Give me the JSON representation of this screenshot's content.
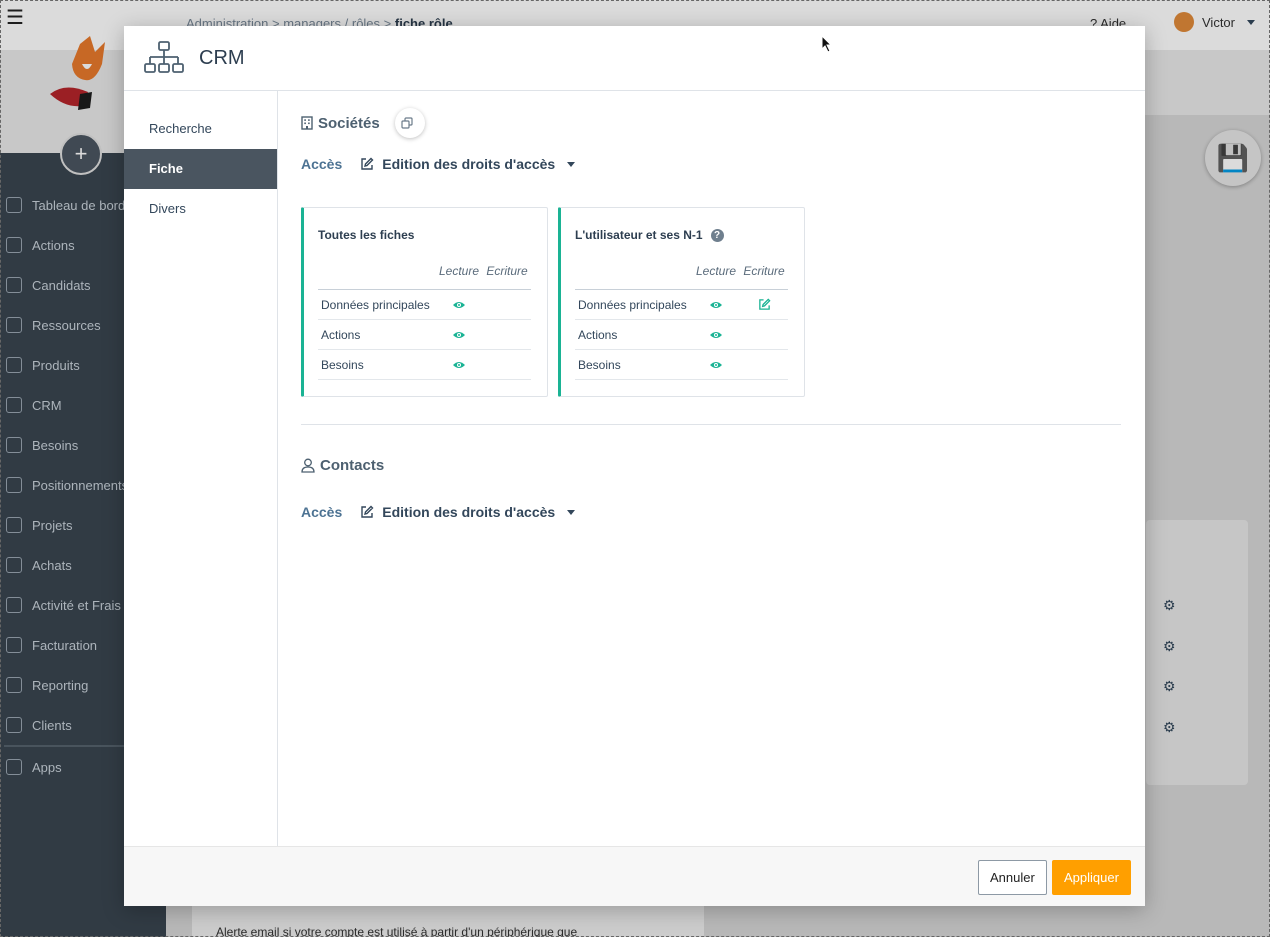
{
  "background": {
    "breadcrumb": [
      "Administration",
      "managers",
      "rôles",
      "fiche rôle"
    ],
    "help_label": "Aide",
    "user_name": "Victor",
    "nav_items": [
      {
        "label": "Tableau de bord",
        "icon": "dashboard-icon"
      },
      {
        "label": "Actions",
        "icon": "calendar-icon"
      },
      {
        "label": "Candidats",
        "icon": "graduation-cap-icon"
      },
      {
        "label": "Ressources",
        "icon": "people-icon"
      },
      {
        "label": "Produits",
        "icon": "book-icon"
      },
      {
        "label": "CRM",
        "icon": "hierarchy-icon"
      },
      {
        "label": "Besoins",
        "icon": "target-icon"
      },
      {
        "label": "Positionnements",
        "icon": "pin-icon"
      },
      {
        "label": "Projets",
        "icon": "briefcase-icon"
      },
      {
        "label": "Achats",
        "icon": "cart-icon"
      },
      {
        "label": "Activité et Frais",
        "icon": "edit-icon"
      },
      {
        "label": "Facturation",
        "icon": "invoice-icon"
      },
      {
        "label": "Reporting",
        "icon": "chart-icon"
      },
      {
        "label": "Clients",
        "icon": "building-icon"
      },
      {
        "label": "Apps",
        "icon": "cubes-icon"
      }
    ],
    "alert_text": "Alerte email si votre compte est utilisé à partir d'un périphérique que"
  },
  "modal": {
    "title": "CRM",
    "side_items": [
      {
        "label": "Recherche",
        "active": false
      },
      {
        "label": "Fiche",
        "active": true
      },
      {
        "label": "Divers",
        "active": false
      }
    ],
    "societes": {
      "title": "Sociétés",
      "access_label": "Accès",
      "edit_label": "Edition des droits d'accès",
      "cards": [
        {
          "title": "Toutes les fiches",
          "has_help": false,
          "col_read": "Lecture",
          "col_write": "Ecriture",
          "rows": [
            {
              "label": "Données principales",
              "read": true,
              "write": false
            },
            {
              "label": "Actions",
              "read": true,
              "write": false
            },
            {
              "label": "Besoins",
              "read": true,
              "write": false
            }
          ]
        },
        {
          "title": "L'utilisateur et ses N-1",
          "has_help": true,
          "col_read": "Lecture",
          "col_write": "Ecriture",
          "rows": [
            {
              "label": "Données principales",
              "read": true,
              "write": true
            },
            {
              "label": "Actions",
              "read": true,
              "write": false
            },
            {
              "label": "Besoins",
              "read": true,
              "write": false
            }
          ]
        }
      ]
    },
    "contacts": {
      "title": "Contacts",
      "access_label": "Accès",
      "edit_label": "Edition des droits d'accès"
    },
    "footer": {
      "cancel_label": "Annuler",
      "apply_label": "Appliquer"
    }
  },
  "colors": {
    "accent_green": "#1ab394",
    "apply_orange": "#ff9f00",
    "sidebar_active": "#4a5560"
  }
}
